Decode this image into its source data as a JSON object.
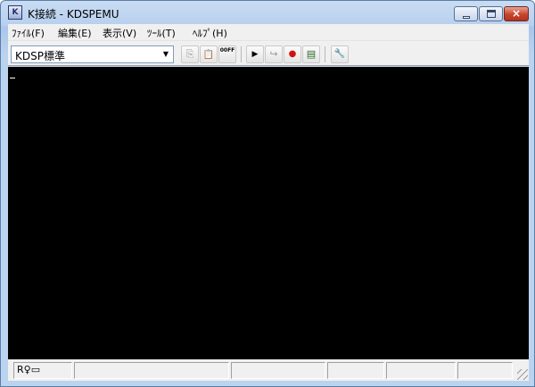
{
  "window": {
    "title": "K接続 - KDSPEMU",
    "app_icon_glyph": "K"
  },
  "menu": {
    "items": [
      {
        "label": "ﾌｧｲﾙ(F)"
      },
      {
        "label": "編集(E)"
      },
      {
        "label": "表示(V)"
      },
      {
        "label": "ﾂｰﾙ(T)"
      },
      {
        "label": "ﾍﾙﾌﾟ(H)"
      }
    ]
  },
  "toolbar": {
    "combo_value": "KDSP標準",
    "buttons": [
      {
        "icon": "copy-icon",
        "glyph": "⎘",
        "enabled": false
      },
      {
        "icon": "paste-icon",
        "glyph": "📋",
        "enabled": false
      },
      {
        "icon": "hex-00ff-icon",
        "glyph": "00FF",
        "enabled": true
      },
      {
        "icon": "play-icon",
        "glyph": "▶",
        "enabled": true
      },
      {
        "icon": "step-icon",
        "glyph": "↪",
        "enabled": false
      },
      {
        "icon": "record-icon",
        "glyph": "●",
        "enabled": true
      },
      {
        "icon": "log-view-icon",
        "glyph": "▤",
        "enabled": true
      },
      {
        "icon": "wrench-icon",
        "glyph": "🔧",
        "enabled": true
      }
    ]
  },
  "terminal": {
    "background": "#000000",
    "cursor_char": "_"
  },
  "statusbar": {
    "icon_glyphs": "R♀▭",
    "panes": [
      "",
      "",
      "",
      "",
      "",
      ""
    ]
  },
  "colors": {
    "close_button": "#c8432c",
    "frame": "#bcd3ef"
  }
}
